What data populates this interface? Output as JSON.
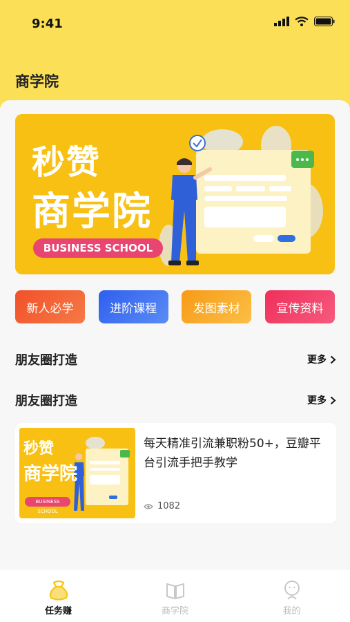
{
  "status_bar": {
    "time": "9:41"
  },
  "header": {
    "title": "商学院"
  },
  "banner": {
    "line1": "秒赞",
    "line2": "商学院",
    "tag": "BUSINESS SCHOOL"
  },
  "categories": [
    {
      "label": "新人必学",
      "color": "#f2502a"
    },
    {
      "label": "进阶课程",
      "color": "#3d6cf0"
    },
    {
      "label": "发图素材",
      "color": "#f7a21a"
    },
    {
      "label": "宣传资料",
      "color": "#f03760"
    }
  ],
  "sections": [
    {
      "title": "朋友圈打造",
      "more": "更多"
    },
    {
      "title": "朋友圈打造",
      "more": "更多"
    }
  ],
  "card": {
    "thumb_line1": "秒赞",
    "thumb_line2": "商学院",
    "thumb_tag": "BUSINESS SCHOOL",
    "title": "每天精准引流兼职粉50+，豆瓣平台引流手把手教学",
    "views": "1082"
  },
  "tabbar": {
    "items": [
      {
        "label": "任务赚",
        "active": true,
        "icon": "task-bag-icon"
      },
      {
        "label": "商学院",
        "active": false,
        "icon": "book-icon"
      },
      {
        "label": "我的",
        "active": false,
        "icon": "profile-icon"
      }
    ],
    "active_color": "#f8c516",
    "inactive_color": "#c8c8c8"
  }
}
